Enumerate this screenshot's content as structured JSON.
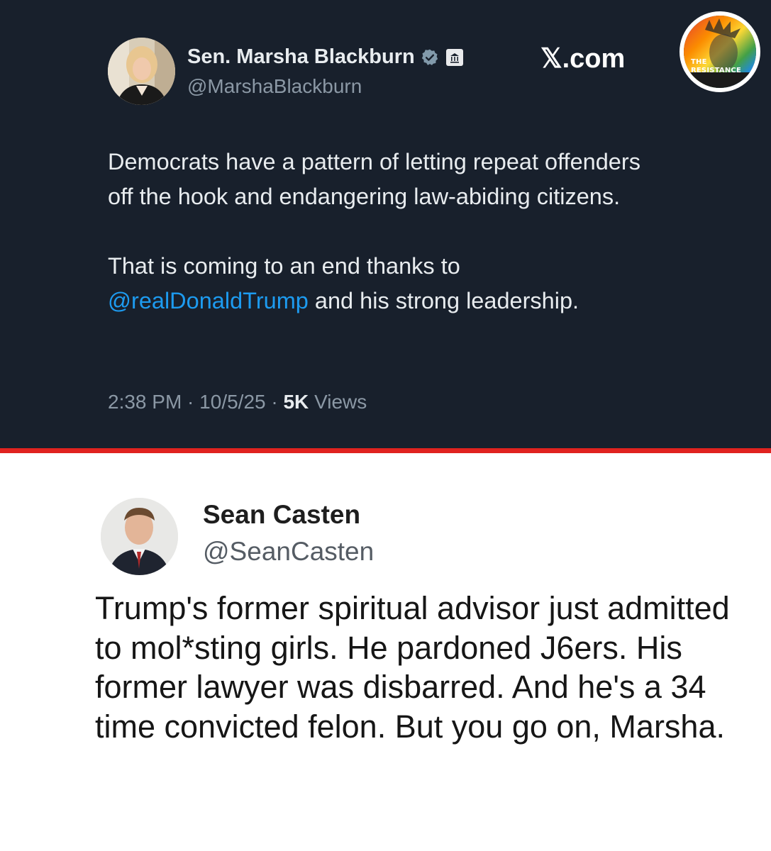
{
  "tweet_top": {
    "display_name": "Sen. Marsha Blackburn",
    "handle": "@MarshaBlackburn",
    "body_line1": "Democrats have a pattern of letting repeat offenders off the hook and endangering law-abiding citizens.",
    "body_line2_prefix": "That is coming to an end thanks to",
    "mention": "@realDonaldTrump",
    "body_line2_suffix": " and his strong leadership.",
    "time": "2:38 PM",
    "date": "10/5/25",
    "views_count": "5K",
    "views_label": "Views",
    "icons": [
      "verified-icon",
      "government-badge-icon"
    ]
  },
  "site_label": "𝕏.com",
  "resistance_badge": {
    "line1": "THE",
    "line2": "RESISTANCE"
  },
  "tweet_bottom": {
    "display_name": "Sean Casten",
    "handle": "@SeanCasten",
    "body": "Trump's former spiritual advisor just admitted to mol*sting girls. He pardoned J6ers.  His former lawyer was disbarred.  And he's a 34 time convicted felon.  But you go on, Marsha."
  },
  "colors": {
    "dark_bg": "#18202c",
    "divider": "#e0231f",
    "mention": "#1d9bf0",
    "verified": "#829aab"
  }
}
